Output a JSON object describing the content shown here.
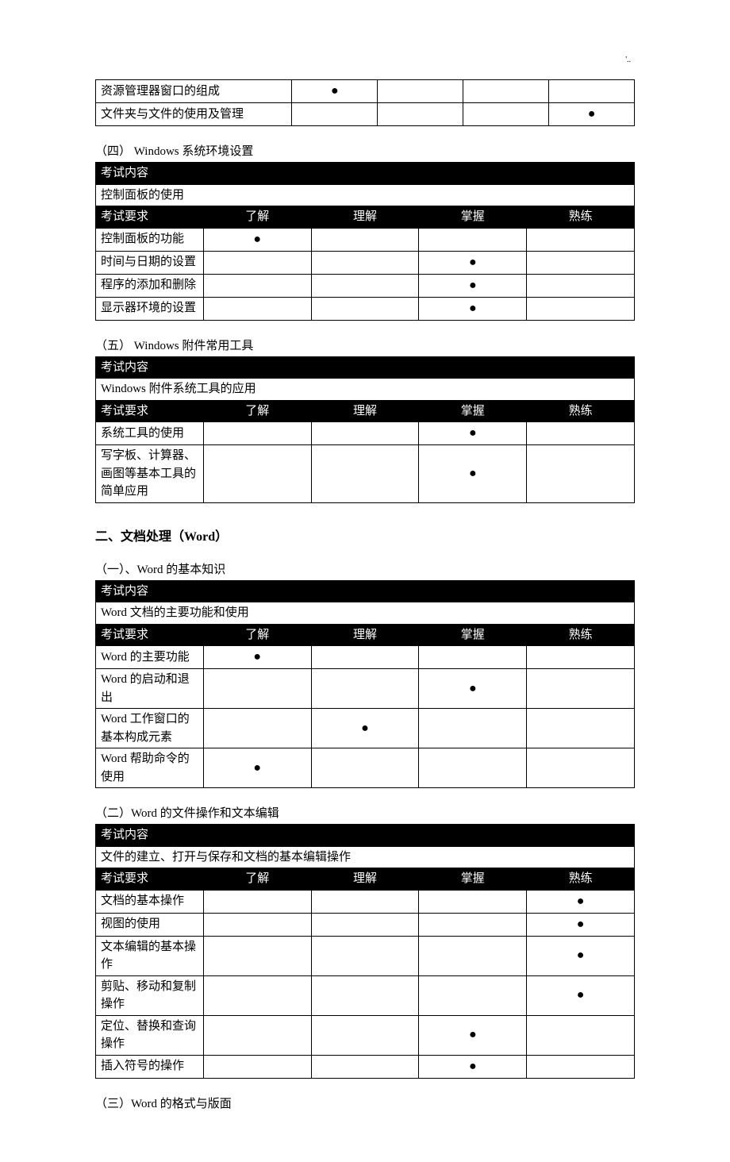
{
  "page_mark": "'..",
  "levels": [
    "了解",
    "理解",
    "掌握",
    "熟练"
  ],
  "label_content": "考试内容",
  "label_req": "考试要求",
  "top_table": {
    "rows": [
      {
        "label": "资源管理器窗口的组成",
        "marks": [
          true,
          false,
          false,
          false
        ]
      },
      {
        "label": "文件夹与文件的使用及管理",
        "marks": [
          false,
          false,
          false,
          true
        ]
      }
    ]
  },
  "sections": [
    {
      "title": "（四） Windows 系统环境设置",
      "content": "控制面板的使用",
      "rows": [
        {
          "label": "控制面板的功能",
          "marks": [
            true,
            false,
            false,
            false
          ]
        },
        {
          "label": "时间与日期的设置",
          "marks": [
            false,
            false,
            true,
            false
          ]
        },
        {
          "label": "程序的添加和删除",
          "marks": [
            false,
            false,
            true,
            false
          ]
        },
        {
          "label": "显示器环境的设置",
          "marks": [
            false,
            false,
            true,
            false
          ]
        }
      ]
    },
    {
      "title": "（五） Windows 附件常用工具",
      "content": "Windows 附件系统工具的应用",
      "rows": [
        {
          "label": "系统工具的使用",
          "marks": [
            false,
            false,
            true,
            false
          ]
        },
        {
          "label": "写字板、计算器、画图等基本工具的简单应用",
          "marks": [
            false,
            false,
            true,
            false
          ]
        }
      ]
    }
  ],
  "big_heading": "二、文档处理（Word）",
  "word_sections": [
    {
      "title": "（一）、Word 的基本知识",
      "content": "Word 文档的主要功能和使用",
      "rows": [
        {
          "label": "Word 的主要功能",
          "marks": [
            true,
            false,
            false,
            false
          ]
        },
        {
          "label": "Word 的启动和退出",
          "marks": [
            false,
            false,
            true,
            false
          ]
        },
        {
          "label": "Word 工作窗口的基本构成元素",
          "marks": [
            false,
            true,
            false,
            false
          ]
        },
        {
          "label": "Word 帮助命令的使用",
          "marks": [
            true,
            false,
            false,
            false
          ]
        }
      ]
    },
    {
      "title": "（二）Word 的文件操作和文本编辑",
      "content": "文件的建立、打开与保存和文档的基本编辑操作",
      "rows": [
        {
          "label": "文档的基本操作",
          "marks": [
            false,
            false,
            false,
            true
          ]
        },
        {
          "label": "视图的使用",
          "marks": [
            false,
            false,
            false,
            true
          ]
        },
        {
          "label": "文本编辑的基本操作",
          "marks": [
            false,
            false,
            false,
            true
          ]
        },
        {
          "label": "剪贴、移动和复制操作",
          "marks": [
            false,
            false,
            false,
            true
          ]
        },
        {
          "label": "定位、替换和查询操作",
          "marks": [
            false,
            false,
            true,
            false
          ]
        },
        {
          "label": "插入符号的操作",
          "marks": [
            false,
            false,
            true,
            false
          ]
        }
      ]
    }
  ],
  "trailing_title": "（三）Word 的格式与版面"
}
